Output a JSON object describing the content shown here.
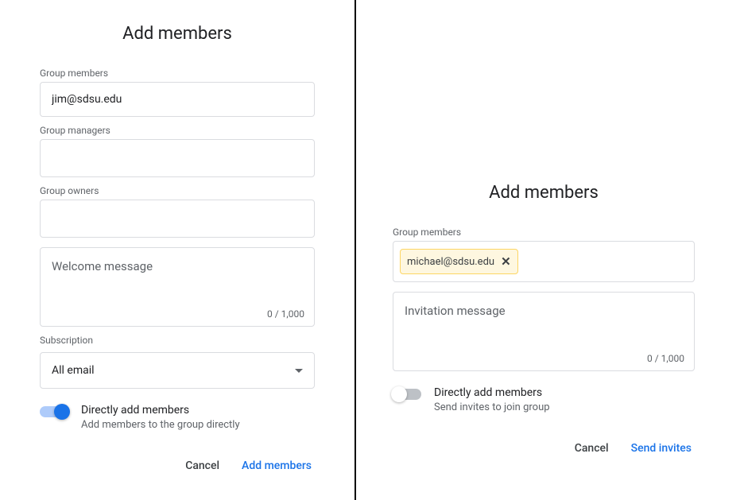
{
  "left": {
    "title": "Add members",
    "group_members_label": "Group members",
    "group_members_value": "jim@sdsu.edu",
    "group_managers_label": "Group managers",
    "group_managers_value": "",
    "group_owners_label": "Group owners",
    "group_owners_value": "",
    "welcome_placeholder": "Welcome message",
    "char_count": "0 / 1,000",
    "subscription_label": "Subscription",
    "subscription_value": "All email",
    "toggle_title": "Directly add members",
    "toggle_sub": "Add members to the group directly",
    "cancel": "Cancel",
    "primary": "Add members"
  },
  "right": {
    "title": "Add members",
    "group_members_label": "Group members",
    "chip_email": "michael@sdsu.edu",
    "chip_close": "✕",
    "invitation_placeholder": "Invitation message",
    "char_count": "0 / 1,000",
    "toggle_title": "Directly add members",
    "toggle_sub": "Send invites to join group",
    "cancel": "Cancel",
    "primary": "Send invites"
  }
}
